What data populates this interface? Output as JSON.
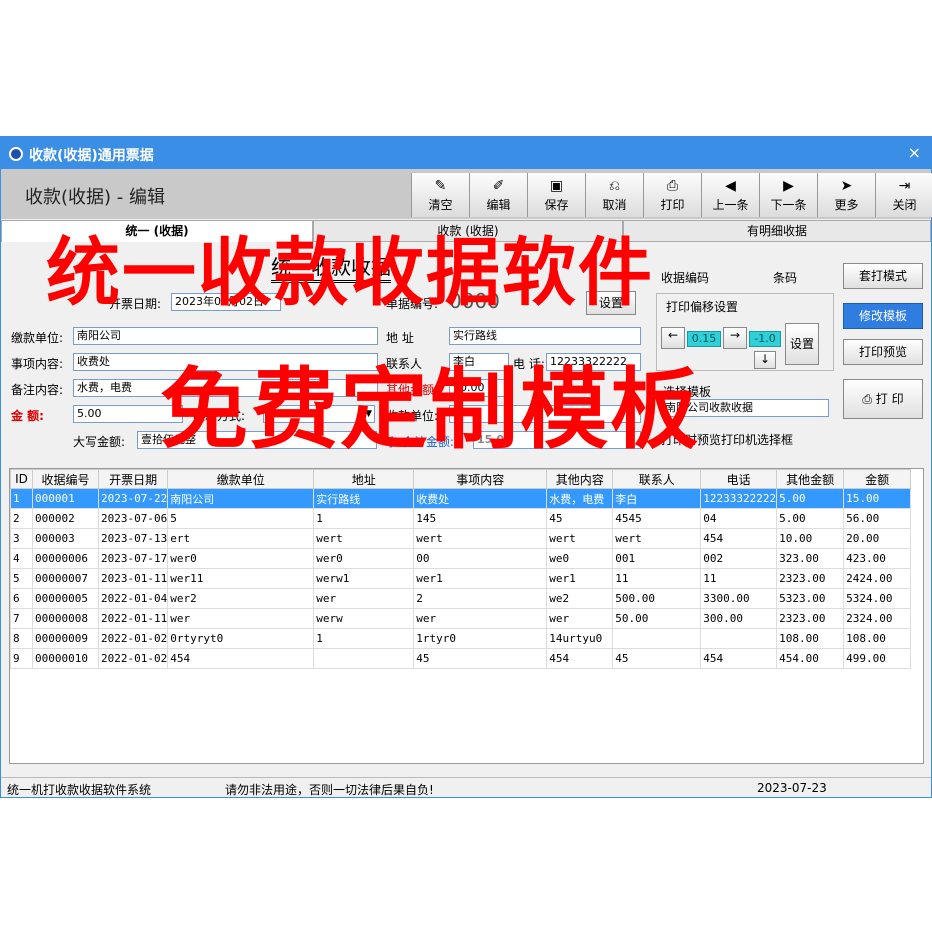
{
  "window": {
    "title": "收款(收据)通用票据",
    "close": "×"
  },
  "header": {
    "title": "收款(收据) - 编辑"
  },
  "toolbar": [
    {
      "icon": "broom-icon",
      "glyph": "✎",
      "label": "清空"
    },
    {
      "icon": "edit-icon",
      "glyph": "✐",
      "label": "编辑"
    },
    {
      "icon": "save-icon",
      "glyph": "▣",
      "label": "保存"
    },
    {
      "icon": "cancel-icon",
      "glyph": "⎌",
      "label": "取消"
    },
    {
      "icon": "printer-icon",
      "glyph": "⎙",
      "label": "打印"
    },
    {
      "icon": "prev-icon",
      "glyph": "◀",
      "label": "上一条"
    },
    {
      "icon": "next-icon",
      "glyph": "▶",
      "label": "下一条"
    },
    {
      "icon": "more-icon",
      "glyph": "➤",
      "label": "更多"
    },
    {
      "icon": "exit-icon",
      "glyph": "⇥",
      "label": "关闭"
    }
  ],
  "tabs": [
    "统一 (收据)",
    "收款 (收据)",
    "有明细收据"
  ],
  "form": {
    "doc_title": "统一收款收据",
    "date_label": "开票日期:",
    "date_value": "2023年05月02日",
    "no_label": "单据编号:",
    "no_value": "0000",
    "set_btn": "设置",
    "payer_label": "缴款单位:",
    "payer_value": "南阳公司",
    "addr_label": "地 址",
    "addr_value": "实行路线",
    "item_label": "事项内容:",
    "item_value": "收费处",
    "contact_label": "联系人",
    "contact_value": "李白",
    "phone_label": "电 话:",
    "phone_value": "12233322222",
    "note_label": "备注内容:",
    "note_value": "水费，电费",
    "other_amount_label": "其他金额:",
    "other_amount_value": "10.00",
    "amount_label": "金 额:",
    "amount_value": "5.00",
    "method_label": "收款方式:",
    "payee_label": "收款单位:",
    "upper_label": "大写金额:",
    "upper_value": "壹拾伍元整",
    "total_label": "小 合计金额:",
    "total_value": "15.00",
    "receipt_label": "收据编码",
    "barcode_label": "条码",
    "offset_label": "打印偏移设置",
    "offset_x": "0.15",
    "offset_y": "-1.0",
    "offset_set": "设置",
    "template_label": "选择模板",
    "template_value": "南阳公司收款收据",
    "preview_check": "打印时预览打印机选择框",
    "mode_btn": "套打模式",
    "edit_tpl_btn": "修改模板",
    "preview_btn": "打印预览",
    "print_btn": "打 印"
  },
  "table": {
    "headers": [
      "ID",
      "收据编号",
      "开票日期",
      "缴款单位",
      "地址",
      "事项内容",
      "其他内容",
      "联系人",
      "电话",
      "其他金额",
      "金额"
    ],
    "rows": [
      [
        "1",
        "000001",
        "2023-07-22",
        "南阳公司",
        "实行路线",
        "收费处",
        "水费，电费",
        "李白",
        "12233322222",
        "5.00",
        "15.00"
      ],
      [
        "2",
        "000002",
        "2023-07-06",
        "5",
        "1",
        "145",
        "45",
        "4545",
        "04",
        "5.00",
        "56.00"
      ],
      [
        "3",
        "000003",
        "2023-07-13",
        "ert",
        "wert",
        "wert",
        "wert",
        "wert",
        "454",
        "10.00",
        "20.00"
      ],
      [
        "4",
        "00000006",
        "2023-07-17",
        "wer0",
        "wer0",
        "00",
        "we0",
        "001",
        "002",
        "323.00",
        "423.00"
      ],
      [
        "5",
        "00000007",
        "2023-01-11",
        "wer11",
        "werw1",
        "wer1",
        "wer1",
        "11",
        "11",
        "2323.00",
        "2424.00"
      ],
      [
        "6",
        "00000005",
        "2022-01-04",
        "wer2",
        "wer",
        "2",
        "we2",
        "500.00",
        "3300.00",
        "5323.00",
        "5324.00"
      ],
      [
        "7",
        "00000008",
        "2022-01-11",
        "wer",
        "werw",
        "wer",
        "wer",
        "50.00",
        "300.00",
        "2323.00",
        "2324.00"
      ],
      [
        "8",
        "00000009",
        "2022-01-02",
        "0rtyryt0",
        "1",
        "1rtyr0",
        "14urtyu0",
        "",
        "",
        "108.00",
        "108.00"
      ],
      [
        "9",
        "00000010",
        "2022-01-02",
        "454",
        "",
        "45",
        "454",
        "45",
        "454",
        "454.00",
        "499.00"
      ]
    ]
  },
  "status": {
    "left": "统一机打收款收据软件系统",
    "mid": "请勿非法用途，否则一切法律后果自负!",
    "date": "2023-07-23"
  },
  "overlay": {
    "line1": "统一收款收据软件",
    "line2": "免费定制模板"
  },
  "colors": {
    "accent": "#3a8ee6",
    "overlay": "#ff0000",
    "selected_row": "#3399ff"
  }
}
